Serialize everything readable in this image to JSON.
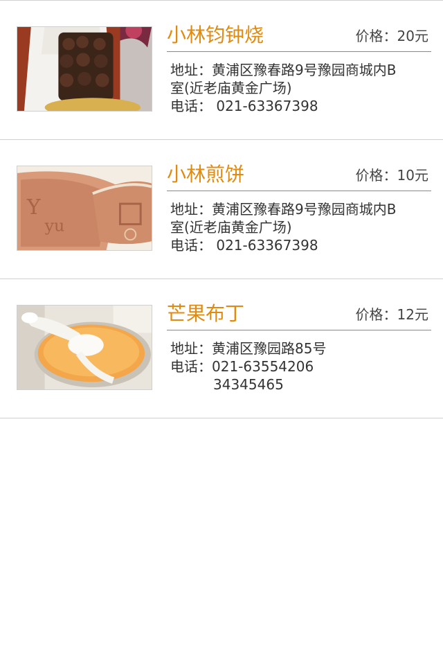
{
  "items": [
    {
      "name": "小林钧钟烧",
      "price": "价格：20元",
      "address_line1": "地址：黄浦区豫春路9号豫园商城内B",
      "address_line2": "室(近老庙黄金广场)",
      "phone": "电话： 021-63367398",
      "image": "dorayaki-box-photo"
    },
    {
      "name": "小林煎饼",
      "price": "价格：10元",
      "address_line1": "地址：黄浦区豫春路9号豫园商城内B",
      "address_line2": "室(近老庙黄金广场)",
      "phone": "电话： 021-63367398",
      "image": "pancake-photo"
    },
    {
      "name": "芒果布丁",
      "price": "价格：12元",
      "address_line1": "地址：黄浦区豫园路85号",
      "phone": "电话：021-63554206",
      "phone2": "34345465",
      "image": "mango-pudding-photo"
    }
  ],
  "colors": {
    "title": "#e08a10",
    "divider": "#d0d0d0",
    "rule": "#888888",
    "text": "#333333"
  }
}
